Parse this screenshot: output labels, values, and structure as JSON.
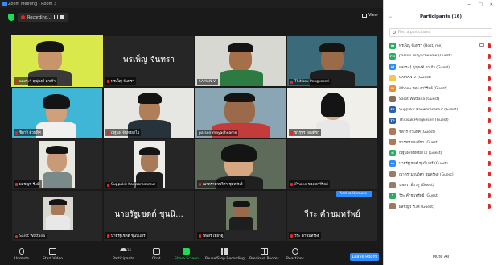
{
  "window": {
    "title": "Zoom Meeting - Room 3"
  },
  "recording": {
    "label": "Recording..."
  },
  "view_button": {
    "label": "View"
  },
  "tiles": [
    {
      "label": "แสงระวีฺ ญปุยงค์ ดาเก้า"
    },
    {
      "big": "พรเพ็ญ จันทรา",
      "label": "พรเพ็ญ จันทรา"
    },
    {
      "label": "SAMAN V."
    },
    {
      "label": "Thitisak Pengkeseri"
    },
    {
      "label": "ชิดาริ ด้วนทิศ"
    },
    {
      "label": "ณัฐนพ จันทรยาไว"
    },
    {
      "label": "parson mayacheame"
    },
    {
      "label": "ชารุชร ทองดีชา"
    },
    {
      "label": "ผลชญช รีเงสิ"
    },
    {
      "label": "Suppakit Kaewbrasamut"
    },
    {
      "label": "ณาตรามวนวิศา ชุมทรัพย์"
    },
    {
      "label": "iPhone ของ อาวีรีลล์"
    },
    {
      "label": "Sarot Wattana"
    },
    {
      "big": "นายรัฐเชดต์ ชุนนิ...",
      "label": "นายรัฐเชดต์ ชุนนิแคร์"
    },
    {
      "label": "นพหร เที่ยวดู"
    },
    {
      "big": "วีระ คำชมทรัพย์",
      "label": "วีระ คำชมทรัพย์"
    }
  ],
  "add_to_unmute": "Add to Unmute",
  "toolbar": {
    "unmute": "Unmute",
    "start_video": "Start Video",
    "participants": "Participants",
    "participants_count": "16",
    "chat": "Chat",
    "share_screen": "Share Screen",
    "recording": "Pause/Stop Recording",
    "breakout": "Breakout Rooms",
    "reactions": "Reactions",
    "leave": "Leave Room"
  },
  "panel": {
    "header": "Participants (16)",
    "search_placeholder": "Find a participant",
    "mute_all": "Mute All",
    "participants": [
      {
        "initials": "พร",
        "color": "#27ae60",
        "name": "พรเพ็ญ จันทรา (Host, me)"
      },
      {
        "initials": "PM",
        "color": "#27ae60",
        "name": "parson mayacheame (Guest)"
      },
      {
        "initials": "แส",
        "color": "#2d8cff",
        "name": "แสงระวีฺ ญปุยงค์ ดาเก้า (Guest)"
      },
      {
        "initials": "",
        "color": "#f2c94c",
        "name": "SAMAN V. (Guest)"
      },
      {
        "initials": "iP",
        "color": "#eb8c34",
        "name": "iPhone ของ อาวีรีลล์ (Guest)"
      },
      {
        "initials": "",
        "color": "#8a6d57",
        "name": "Sarot Wattana (Guest)"
      },
      {
        "initials": "SK",
        "color": "#2b5faa",
        "name": "Suppakit Kaewbrasamut (Guest)"
      },
      {
        "initials": "TP",
        "color": "#2b5faa",
        "name": "Thitisak Pengkeseri (Guest)"
      },
      {
        "initials": "",
        "color": "#b0785a",
        "name": "ชิดาริ ด้วนทิศ (Guest)"
      },
      {
        "initials": "",
        "color": "#b0785a",
        "name": "ชารุชร ทองดีชา (Guest)"
      },
      {
        "initials": "ณั",
        "color": "#27ae60",
        "name": "ณัฐนพ จันทรยาไว (Guest)"
      },
      {
        "initials": "นา",
        "color": "#2d8cff",
        "name": "นายรัฐเชดต์ ชุนนิแคร์ (Guest)"
      },
      {
        "initials": "",
        "color": "#9a7b6a",
        "name": "ณาตรามวนวิศา ชุมทรัพย์ (Guest)"
      },
      {
        "initials": "",
        "color": "#9a7b6a",
        "name": "นพหร เที่ยวดู (Guest)"
      },
      {
        "initials": "วี",
        "color": "#27ae60",
        "name": "วีระ คำชมทรัพย์ (Guest)"
      },
      {
        "initials": "",
        "color": "#a07860",
        "name": "ผลชญช รีเงสิ (Guest)"
      }
    ]
  }
}
